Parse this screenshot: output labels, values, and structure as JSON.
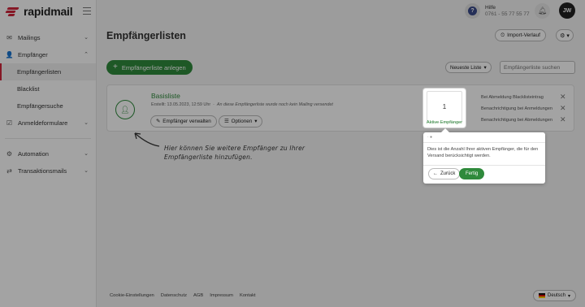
{
  "brand": {
    "name": "rapidmail",
    "accent": "#d0243b",
    "green": "#2f8a3c"
  },
  "sidebar": {
    "items": [
      {
        "label": "Mailings",
        "icon": "mail-icon"
      },
      {
        "label": "Empfänger",
        "icon": "user-icon"
      },
      {
        "label": "Empfängerlisten"
      },
      {
        "label": "Blacklist"
      },
      {
        "label": "Empfängersuche"
      },
      {
        "label": "Anmeldeformulare",
        "icon": "form-icon"
      },
      {
        "label": "Automation",
        "icon": "automation-icon"
      },
      {
        "label": "Transaktionsmails",
        "icon": "transaction-icon"
      }
    ]
  },
  "header": {
    "help_label": "Hilfe",
    "help_phone": "0761 - 55 77 55 77",
    "avatar_initials": "JW"
  },
  "page": {
    "title": "Empfängerlisten",
    "import_label": "Import-Verlauf",
    "create_label": "Empfängerliste anlegen",
    "sort_label": "Neueste Liste",
    "search_placeholder": "Empfängerliste suchen"
  },
  "list": {
    "name": "Basisliste",
    "meta_created": "Erstellt: 13.05.2023, 12:59 Uhr",
    "meta_note": "An diese Empfängerliste wurde noch kein Mailing versendet",
    "manage_label": "Empfänger verwalten",
    "options_label": "Optionen",
    "active_count": "1",
    "active_label": "Aktive Empfänger",
    "notifications": [
      "Bei Abmeldung Blacklisteintrag",
      "Benachrichtigung bei Anmeldungen",
      "Benachrichtigung bei Abmeldungen"
    ]
  },
  "annotation": {
    "line1": "Hier können Sie weitere Empfänger zu Ihrer",
    "line2": "Empfängerliste hinzufügen."
  },
  "tooltip": {
    "head": "· ●",
    "text": "Dies ist die Anzahl Ihrer aktiven Empfänger, die für den Versand berücksichtigt werden.",
    "back_label": "Zurück",
    "done_label": "Fertig"
  },
  "footer": {
    "links": [
      "Cookie-Einstellungen",
      "Datenschutz",
      "AGB",
      "Impressum",
      "Kontakt"
    ],
    "language": "Deutsch"
  }
}
